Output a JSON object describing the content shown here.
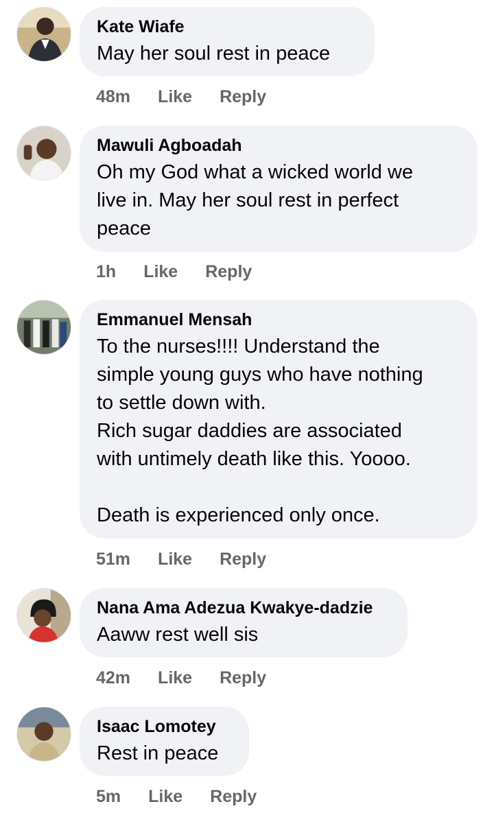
{
  "comments": [
    {
      "author": "Kate Wiafe",
      "text": "May her soul rest in peace",
      "time": "48m",
      "like": "Like",
      "reply": "Reply"
    },
    {
      "author": "Mawuli Agboadah",
      "text": "Oh my God what a wicked world we\nlive in. May her soul rest in perfect\npeace",
      "time": "1h",
      "like": "Like",
      "reply": "Reply"
    },
    {
      "author": "Emmanuel Mensah",
      "text": "To the nurses!!!! Understand the\nsimple young guys who have nothing\nto settle down with.\nRich sugar daddies are associated\nwith untimely death like this. Yoooo.\n\nDeath is experienced only once.",
      "time": "51m",
      "like": "Like",
      "reply": "Reply"
    },
    {
      "author": "Nana Ama Adezua Kwakye-dadzie",
      "text": "Aaww rest well sis",
      "time": "42m",
      "like": "Like",
      "reply": "Reply"
    },
    {
      "author": "Isaac Lomotey",
      "text": "Rest in peace",
      "time": "5m",
      "like": "Like",
      "reply": "Reply"
    }
  ],
  "colors": {
    "bubble": "#f0f2f5",
    "meta": "#65676b",
    "text": "#050505"
  }
}
